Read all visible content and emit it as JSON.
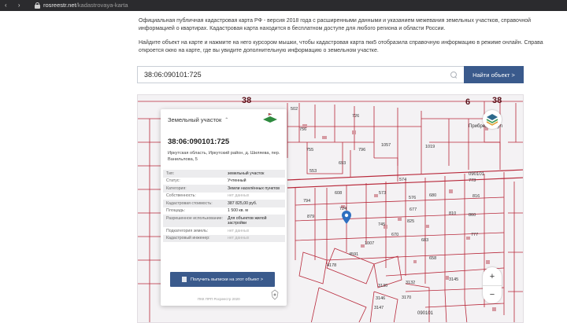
{
  "browser": {
    "url_host": "rosreestr.net",
    "url_path": "/kadastrovaya-karta"
  },
  "intro": {
    "paragraph1": "Официальная публичная кадастровая карта РФ - версия 2018 года с расширенными данными и указанием межевания земельных участков, справочной информацией о квартирах. Кадастровая карта находится в бесплатном доступе для любого региона и области России.",
    "paragraph2": "Найдите объект на карте и нажмите на него курсором мышки, чтобы кадастровая карта пкк5 отобразила справочную информацию в режиме онлайн. Справа откроется окно на карте, где вы увидите дополнительную информацию о земельном участке."
  },
  "search": {
    "value": "38:06:090101:725",
    "button_label": "Найти объект >"
  },
  "card": {
    "type_header": "Земельный участок",
    "cad_number": "38:06:090101:725",
    "address": "Иркутская область, Иркутский район, д. Шиляева, пер. Ванильлова, 5",
    "rows": [
      {
        "k": "Тип:",
        "v": "земельный участок",
        "muted": false
      },
      {
        "k": "Статус:",
        "v": "Учтенный",
        "muted": false
      },
      {
        "k": "Категория:",
        "v": "Земли населённых пунктов",
        "muted": false
      },
      {
        "k": "Собственность:",
        "v": "нет данных",
        "muted": true
      },
      {
        "k": "Кадастровая стоимость:",
        "v": "387 825,00 руб.",
        "muted": false
      },
      {
        "k": "Площадь:",
        "v": "1 500 кв. м",
        "muted": false
      },
      {
        "k": "Разрешенное использование:",
        "v": "Для объектов жилой застройки",
        "muted": false
      },
      {
        "k": "Подкатегория земель:",
        "v": "нет данных",
        "muted": true
      },
      {
        "k": "Кадастровый инженер:",
        "v": "нет данных",
        "muted": true
      }
    ],
    "button_label": "Получить выписки на этот объект >",
    "footer": "ПКК ПРП Росреестр 2020"
  },
  "map": {
    "block_numbers": [
      "38",
      "6",
      "38"
    ],
    "plots": [
      "502",
      "726",
      "756",
      "755",
      "553",
      "796",
      "693",
      "1057",
      "1019",
      "794",
      "724",
      "608",
      "573",
      "574",
      "576",
      "680",
      "677",
      "810",
      "879",
      "825",
      "745",
      "670",
      "683",
      "1007",
      "4591",
      "4178",
      "3146",
      "3147",
      "3130",
      "3132",
      "3170",
      "573",
      "601",
      "602",
      "777",
      "773",
      "816",
      "860",
      "777",
      "3145",
      "658",
      "641"
    ],
    "street_labels": [
      "Прибрежная ул",
      "090101",
      "090101"
    ],
    "zoom_in": "+",
    "zoom_out": "−"
  }
}
